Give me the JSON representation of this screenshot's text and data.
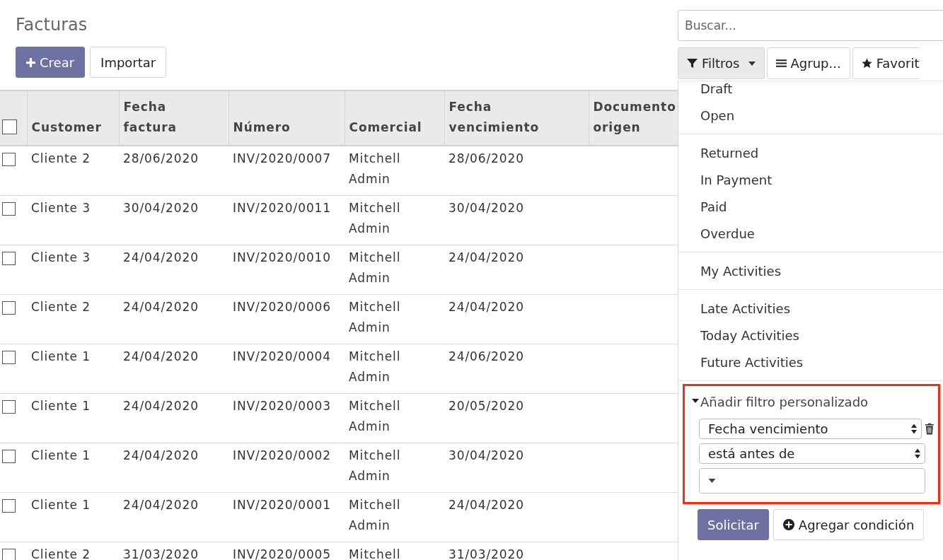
{
  "title": "Facturas",
  "buttons": {
    "create": "Crear",
    "import": "Importar"
  },
  "search": {
    "placeholder": "Buscar..."
  },
  "search_buttons": [
    {
      "kind": "filter",
      "label": "Filtros",
      "expanded": true
    },
    {
      "kind": "group",
      "label": "Agrup...",
      "expanded": false
    },
    {
      "kind": "favorite",
      "label": "Favorit",
      "expanded": false
    }
  ],
  "table": {
    "all_checked": false,
    "columns": [
      "Customer",
      "Fecha factura",
      "Número",
      "Comercial",
      "Fecha vencimiento",
      "Documento origen"
    ],
    "rows": [
      {
        "checked": false,
        "cells": [
          "Cliente 2",
          "28/06/2020",
          "INV/2020/0007",
          "Mitchell Admin",
          "28/06/2020",
          ""
        ]
      },
      {
        "checked": false,
        "cells": [
          "Cliente 3",
          "30/04/2020",
          "INV/2020/0011",
          "Mitchell Admin",
          "30/04/2020",
          ""
        ]
      },
      {
        "checked": false,
        "cells": [
          "Cliente 3",
          "24/04/2020",
          "INV/2020/0010",
          "Mitchell Admin",
          "24/04/2020",
          ""
        ]
      },
      {
        "checked": false,
        "cells": [
          "Cliente 2",
          "24/04/2020",
          "INV/2020/0006",
          "Mitchell Admin",
          "24/04/2020",
          ""
        ]
      },
      {
        "checked": false,
        "cells": [
          "Cliente 1",
          "24/04/2020",
          "INV/2020/0004",
          "Mitchell Admin",
          "24/06/2020",
          ""
        ]
      },
      {
        "checked": false,
        "cells": [
          "Cliente 1",
          "24/04/2020",
          "INV/2020/0003",
          "Mitchell Admin",
          "20/05/2020",
          ""
        ]
      },
      {
        "checked": false,
        "cells": [
          "Cliente 1",
          "24/04/2020",
          "INV/2020/0002",
          "Mitchell Admin",
          "30/04/2020",
          ""
        ]
      },
      {
        "checked": false,
        "cells": [
          "Cliente 1",
          "24/04/2020",
          "INV/2020/0001",
          "Mitchell Admin",
          "24/04/2020",
          ""
        ]
      },
      {
        "checked": false,
        "cells": [
          "Cliente 2",
          "31/03/2020",
          "INV/2020/0005",
          "Mitchell",
          "31/03/2020",
          ""
        ]
      }
    ]
  },
  "filter_menu": {
    "groups": [
      [
        "Draft",
        "Open"
      ],
      [
        "Returned",
        "In Payment",
        "Paid",
        "Overdue"
      ],
      [
        "My Activities"
      ],
      [
        "Late Activities",
        "Today Activities",
        "Future Activities"
      ]
    ],
    "custom_filter": {
      "title": "Añadir filtro personalizado",
      "expanded": true,
      "highlighted": true,
      "field": "Fecha vencimiento",
      "operator": "está antes de",
      "apply": "Solicitar",
      "add_condition": "Agregar condición"
    }
  }
}
